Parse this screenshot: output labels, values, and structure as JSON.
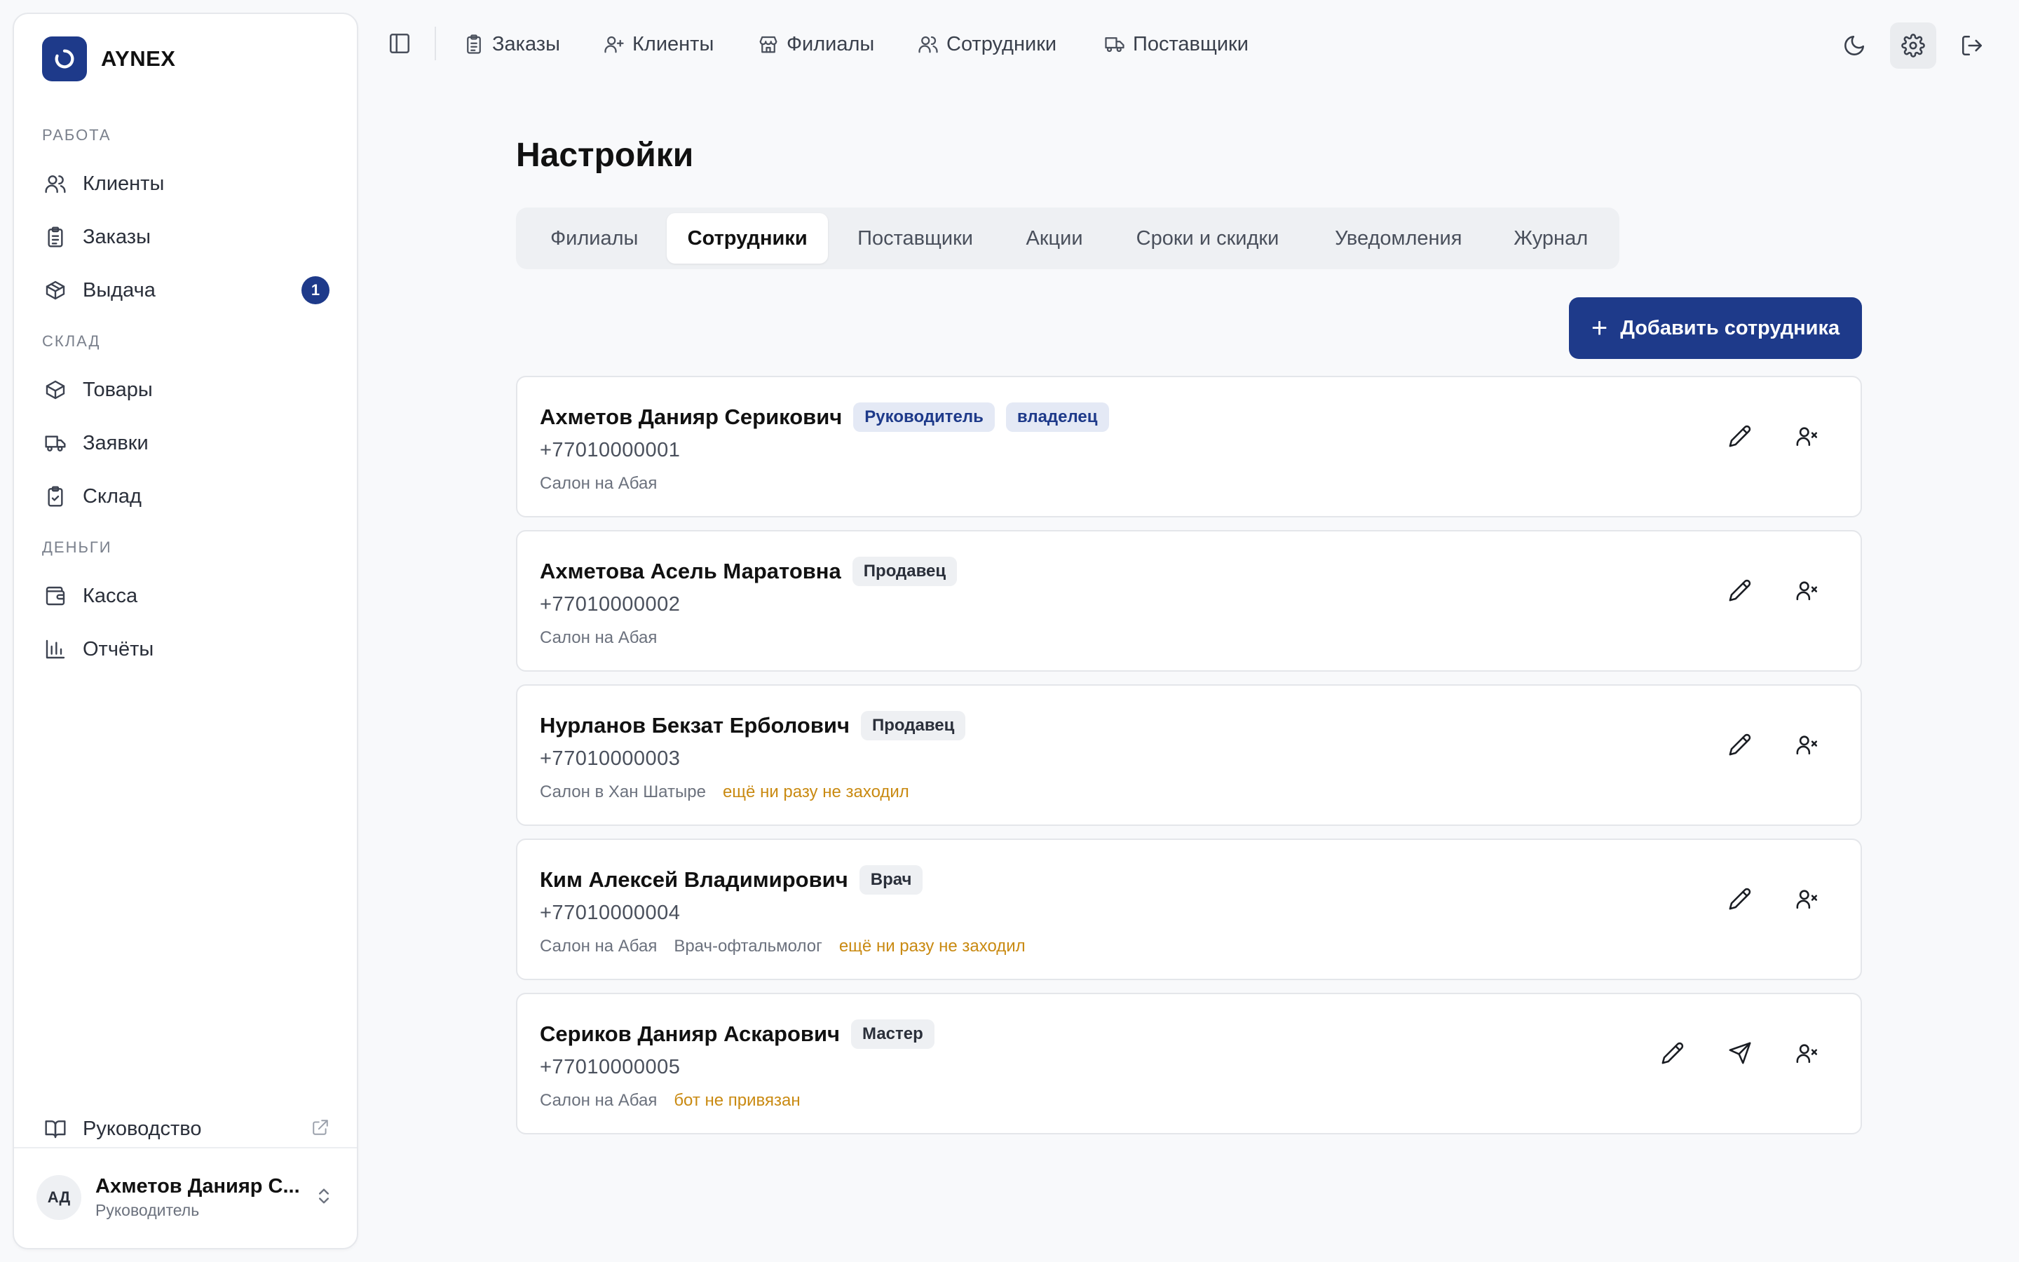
{
  "brand": {
    "name": "AYNEX",
    "accent": "#1e3a8a"
  },
  "sidebar": {
    "sections": {
      "work": "РАБОТА",
      "warehouse": "СКЛАД",
      "money": "ДЕНЬГИ"
    },
    "items": [
      {
        "label": "Клиенты",
        "icon": "users-icon"
      },
      {
        "label": "Заказы",
        "icon": "clipboard-icon"
      },
      {
        "label": "Выдача",
        "icon": "package-check-icon",
        "badge": "1"
      },
      {
        "label": "Товары",
        "icon": "box-icon"
      },
      {
        "label": "Заявки",
        "icon": "truck-icon"
      },
      {
        "label": "Склад",
        "icon": "clipboard-check-icon"
      },
      {
        "label": "Касса",
        "icon": "wallet-icon"
      },
      {
        "label": "Отчёты",
        "icon": "bar-chart-icon"
      }
    ],
    "guide": {
      "label": "Руководство",
      "icon": "book-icon"
    },
    "user": {
      "initials": "АД",
      "name": "Ахметов Данияр С...",
      "role": "Руководитель"
    }
  },
  "topbar": {
    "links": [
      {
        "label": "Заказы",
        "icon": "clipboard-icon"
      },
      {
        "label": "Клиенты",
        "icon": "user-plus-icon"
      },
      {
        "label": "Филиалы",
        "icon": "store-icon"
      },
      {
        "label": "Сотрудники",
        "icon": "users-icon"
      },
      {
        "label": "Поставщики",
        "icon": "truck-icon"
      }
    ]
  },
  "page": {
    "title": "Настройки",
    "tabs": [
      "Филиалы",
      "Сотрудники",
      "Поставщики",
      "Акции",
      "Сроки и скидки",
      "Уведомления",
      "Журнал"
    ],
    "active_tab": "Сотрудники",
    "add_button": "Добавить сотрудника"
  },
  "employees": [
    {
      "name": "Ахметов Данияр Серикович",
      "badges": [
        "Руководитель",
        "владелец"
      ],
      "phone": "+77010000001",
      "meta": [
        "Салон на Абая"
      ]
    },
    {
      "name": "Ахметова Асель Маратовна",
      "badges": [
        "Продавец"
      ],
      "phone": "+77010000002",
      "meta": [
        "Салон на Абая"
      ]
    },
    {
      "name": "Нурланов Бекзат Ерболович",
      "badges": [
        "Продавец"
      ],
      "phone": "+77010000003",
      "meta": [
        "Салон в Хан Шатыре",
        "ещё ни разу не заходил"
      ]
    },
    {
      "name": "Ким Алексей Владимирович",
      "badges": [
        "Врач"
      ],
      "phone": "+77010000004",
      "meta": [
        "Салон на Абая",
        "Врач-офтальмолог",
        "ещё ни разу не заходил"
      ]
    },
    {
      "name": "Сериков Данияр Аскарович",
      "badges": [
        "Мастер"
      ],
      "phone": "+77010000005",
      "meta": [
        "Салон на Абая",
        "бот не привязан"
      ]
    }
  ]
}
